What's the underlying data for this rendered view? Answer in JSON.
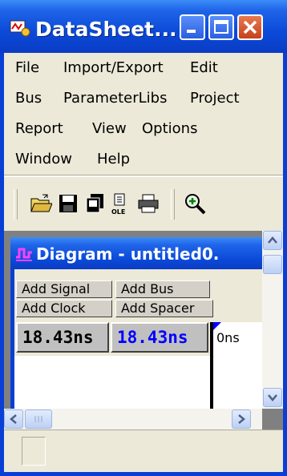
{
  "window": {
    "title": "DataSheet...",
    "controls": {
      "minimize": "minimize",
      "maximize": "maximize",
      "close": "close"
    }
  },
  "menu": {
    "rows": [
      [
        "File",
        "Import/Export",
        "Edit"
      ],
      [
        "Bus",
        "ParameterLibs",
        "Project"
      ],
      [
        "Report",
        "View",
        "Options"
      ],
      [
        "Window",
        "Help"
      ]
    ]
  },
  "toolbar": {
    "buttons": [
      "open-folder-icon",
      "save-icon",
      "copy-icon",
      "ole-icon",
      "print-icon",
      "zoom-icon"
    ],
    "ole_label": "OLE"
  },
  "diagram": {
    "title": "Diagram - untitled0.",
    "buttons": {
      "add_signal": "Add Signal",
      "add_bus": "Add Bus",
      "add_clock": "Add Clock",
      "add_spacer": "Add Spacer"
    },
    "time_primary": "18.43ns",
    "time_delta": "18.43ns",
    "time_axis_label": "0ns",
    "colors": {
      "primary": "#000000",
      "delta": "#0000ff",
      "cursor": "#0000ff"
    }
  }
}
